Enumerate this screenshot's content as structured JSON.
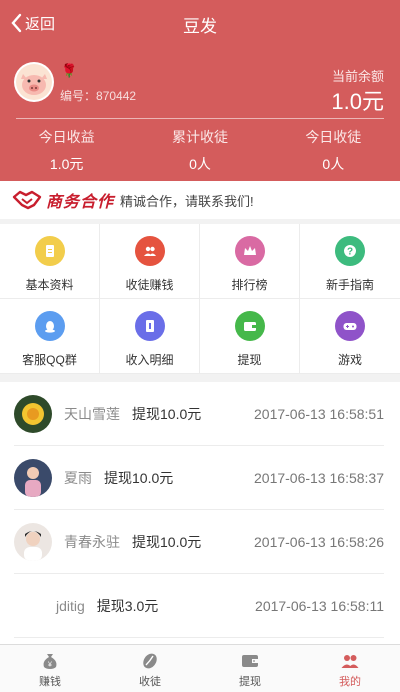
{
  "nav": {
    "back_label": "返回",
    "title": "豆发"
  },
  "profile": {
    "rose_icon": "rose-icon",
    "id_label": "编号：",
    "id_value": "870442",
    "balance_label": "当前余额",
    "balance_value": "1.0元"
  },
  "stats": [
    {
      "label": "今日收益",
      "value": "1.0元"
    },
    {
      "label": "累计收徒",
      "value": "0人"
    },
    {
      "label": "今日收徒",
      "value": "0人"
    }
  ],
  "banner": {
    "logo_text": "商务合作",
    "slogan": "精诚合作，请联系我们!"
  },
  "menu": [
    {
      "label": "基本资料",
      "icon": "document-icon",
      "color": "#f2cd4b"
    },
    {
      "label": "收徒赚钱",
      "icon": "users-icon",
      "color": "#e5533f"
    },
    {
      "label": "排行榜",
      "icon": "crown-icon",
      "color": "#d96aa3"
    },
    {
      "label": "新手指南",
      "icon": "question-icon",
      "color": "#3dbb7e"
    },
    {
      "label": "客服QQ群",
      "icon": "qq-icon",
      "color": "#5c9df0"
    },
    {
      "label": "收入明细",
      "icon": "receipt-icon",
      "color": "#6a6ee8"
    },
    {
      "label": "提现",
      "icon": "wallet-icon",
      "color": "#45b84a"
    },
    {
      "label": "游戏",
      "icon": "gamepad-icon",
      "color": "#8f53c9"
    }
  ],
  "withdrawals": [
    {
      "name": "天山雪莲",
      "amount": "提现10.0元",
      "time": "2017-06-13 16:58:51"
    },
    {
      "name": "夏雨",
      "amount": "提现10.0元",
      "time": "2017-06-13 16:58:37"
    },
    {
      "name": "青春永驻",
      "amount": "提现10.0元",
      "time": "2017-06-13 16:58:26"
    },
    {
      "name": "jditig",
      "amount": "提现3.0元",
      "time": "2017-06-13 16:58:11"
    }
  ],
  "tabs": [
    {
      "label": "赚钱",
      "icon": "money-bag-icon"
    },
    {
      "label": "收徒",
      "icon": "coffee-bean-icon"
    },
    {
      "label": "提现",
      "icon": "wallet-icon"
    },
    {
      "label": "我的",
      "icon": "users-icon",
      "active": true
    }
  ],
  "colors": {
    "header": "#d45c5c",
    "accent": "#d45c5c",
    "banner_red": "#c81e2e"
  }
}
